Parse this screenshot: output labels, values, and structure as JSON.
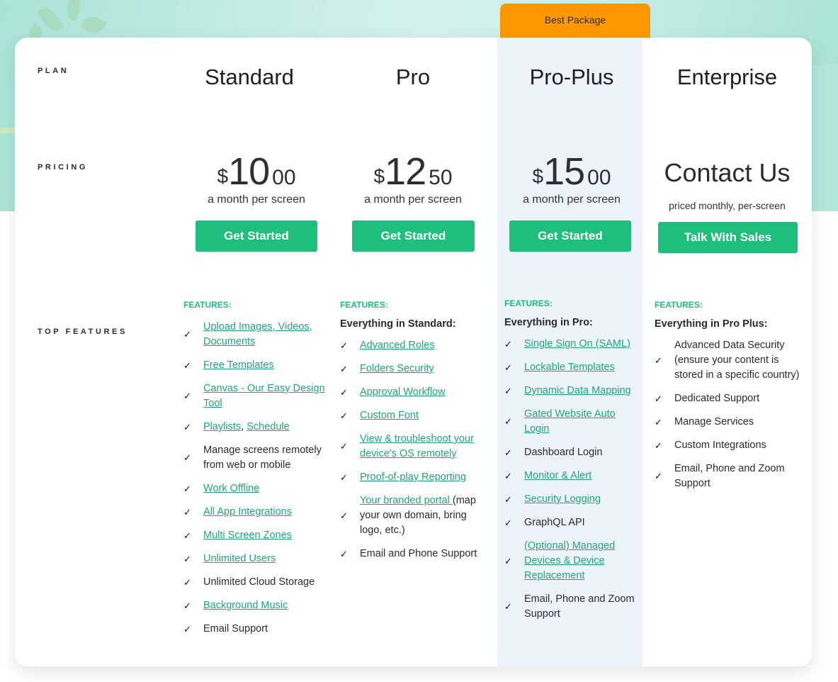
{
  "row_labels": {
    "plan": "PLAN",
    "pricing": "PRICING",
    "top_features": "TOP FEATURES"
  },
  "badge": "Best Package",
  "colors": {
    "accent_green": "#1ebe7c",
    "badge_orange": "#ff9800",
    "highlight_bg": "#edf3fb"
  },
  "plans": [
    {
      "name": "Standard",
      "currency": "$",
      "price_main": "10",
      "price_cents": "00",
      "period": "a month per screen",
      "cta": "Get Started",
      "features_title": "FEATURES:",
      "features_subtitle": "",
      "features": [
        {
          "parts": [
            {
              "text": "Upload Images, Videos, Documents",
              "link": true
            }
          ]
        },
        {
          "parts": [
            {
              "text": "Free Templates",
              "link": true
            }
          ]
        },
        {
          "parts": [
            {
              "text": "Canvas - Our Easy Design Tool",
              "link": true
            }
          ]
        },
        {
          "parts": [
            {
              "text": "Playlists",
              "link": true
            },
            {
              "text": ", ",
              "link": false
            },
            {
              "text": "Schedule",
              "link": true
            }
          ]
        },
        {
          "parts": [
            {
              "text": "Manage screens remotely from web or mobile",
              "link": false
            }
          ]
        },
        {
          "parts": [
            {
              "text": "Work Offline",
              "link": true
            }
          ]
        },
        {
          "parts": [
            {
              "text": "All App Integrations",
              "link": true
            }
          ]
        },
        {
          "parts": [
            {
              "text": "Multi Screen Zones",
              "link": true
            }
          ]
        },
        {
          "parts": [
            {
              "text": "Unlimited Users",
              "link": true
            }
          ]
        },
        {
          "parts": [
            {
              "text": "Unlimited Cloud Storage",
              "link": false
            }
          ]
        },
        {
          "parts": [
            {
              "text": "Background Music",
              "link": true
            }
          ]
        },
        {
          "parts": [
            {
              "text": "Email Support",
              "link": false
            }
          ]
        }
      ]
    },
    {
      "name": "Pro",
      "currency": "$",
      "price_main": "12",
      "price_cents": "50",
      "period": "a month per screen",
      "cta": "Get Started",
      "features_title": "FEATURES:",
      "features_subtitle": "Everything in Standard:",
      "features": [
        {
          "parts": [
            {
              "text": "Advanced Roles",
              "link": true
            }
          ]
        },
        {
          "parts": [
            {
              "text": "Folders Security",
              "link": true
            }
          ]
        },
        {
          "parts": [
            {
              "text": "Approval Workflow",
              "link": true
            }
          ]
        },
        {
          "parts": [
            {
              "text": "Custom Font",
              "link": true
            }
          ]
        },
        {
          "parts": [
            {
              "text": "View & troubleshoot your device's OS remotely",
              "link": true
            }
          ]
        },
        {
          "parts": [
            {
              "text": "Proof-of-play Reporting",
              "link": true
            }
          ]
        },
        {
          "parts": [
            {
              "text": "Your branded portal ",
              "link": true
            },
            {
              "text": "(map your own domain, bring logo, etc.)",
              "link": false
            }
          ]
        },
        {
          "parts": [
            {
              "text": "Email and Phone Support",
              "link": false
            }
          ]
        }
      ]
    },
    {
      "name": "Pro-Plus",
      "currency": "$",
      "price_main": "15",
      "price_cents": "00",
      "period": "a month per screen",
      "cta": "Get Started",
      "features_title": "FEATURES:",
      "features_subtitle": "Everything in Pro:",
      "features": [
        {
          "parts": [
            {
              "text": "Single Sign On (SAML)",
              "link": true
            }
          ]
        },
        {
          "parts": [
            {
              "text": "Lockable Templates",
              "link": true
            }
          ]
        },
        {
          "parts": [
            {
              "text": "Dynamic Data Mapping",
              "link": true
            }
          ]
        },
        {
          "parts": [
            {
              "text": "Gated Website Auto Login",
              "link": true
            }
          ]
        },
        {
          "parts": [
            {
              "text": "Dashboard Login",
              "link": false
            }
          ]
        },
        {
          "parts": [
            {
              "text": "Monitor & Alert",
              "link": true
            }
          ]
        },
        {
          "parts": [
            {
              "text": "Security Logging",
              "link": true
            }
          ]
        },
        {
          "parts": [
            {
              "text": "GraphQL API",
              "link": false
            }
          ]
        },
        {
          "parts": [
            {
              "text": "(Optional) Managed Devices & Device Replacement",
              "link": true
            }
          ]
        },
        {
          "parts": [
            {
              "text": "Email, Phone and Zoom Support",
              "link": false
            }
          ]
        }
      ]
    },
    {
      "name": "Enterprise",
      "contact": "Contact Us",
      "contact_sub": "priced monthly, per-screen",
      "cta": "Talk With Sales",
      "features_title": "FEATURES:",
      "features_subtitle": "Everything in Pro Plus:",
      "features": [
        {
          "parts": [
            {
              "text": "Advanced Data Security (ensure your content is stored in a specific country)",
              "link": false
            }
          ]
        },
        {
          "parts": [
            {
              "text": "Dedicated Support",
              "link": false
            }
          ]
        },
        {
          "parts": [
            {
              "text": "Manage Services",
              "link": false
            }
          ]
        },
        {
          "parts": [
            {
              "text": "Custom Integrations",
              "link": false
            }
          ]
        },
        {
          "parts": [
            {
              "text": "Email, Phone and Zoom Support",
              "link": false
            }
          ]
        }
      ]
    }
  ]
}
